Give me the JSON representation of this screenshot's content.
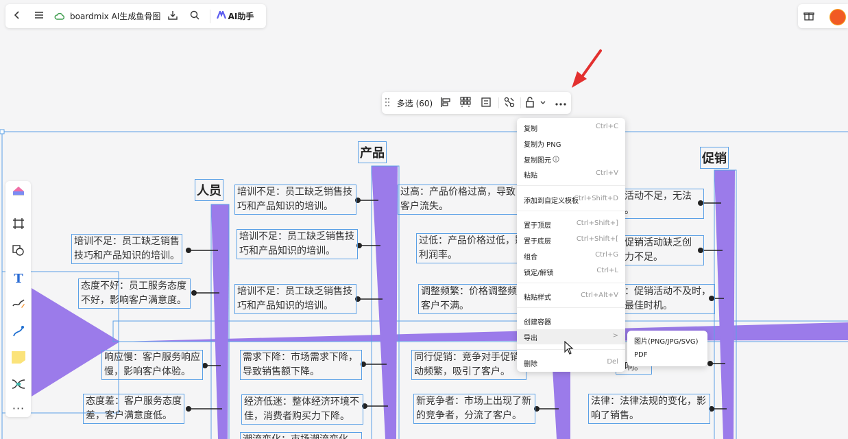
{
  "topbar": {
    "title": "boardmix AI生成鱼骨图",
    "ai_label": "AI助手"
  },
  "selection_toolbar": {
    "multi_select_label": "多选 (60)"
  },
  "context_menu": {
    "items": [
      {
        "label": "复制",
        "shortcut": "Ctrl+C"
      },
      {
        "label": "复制为 PNG",
        "shortcut": ""
      },
      {
        "label": "复制图元",
        "shortcut": ""
      },
      {
        "label": "粘贴",
        "shortcut": "Ctrl+V"
      },
      {
        "label": "添加到自定义模板",
        "shortcut": "Ctrl+Shift+D"
      },
      {
        "label": "置于顶层",
        "shortcut": "Ctrl+Shift+]"
      },
      {
        "label": "置于底层",
        "shortcut": "Ctrl+Shift+["
      },
      {
        "label": "组合",
        "shortcut": "Ctrl+G"
      },
      {
        "label": "锁定/解锁",
        "shortcut": "Ctrl+L"
      },
      {
        "label": "粘贴样式",
        "shortcut": "Ctrl+Alt+V"
      },
      {
        "label": "创建容器",
        "shortcut": ""
      },
      {
        "label": "导出",
        "shortcut": ">"
      },
      {
        "label": "删除",
        "shortcut": "Del"
      }
    ],
    "export_submenu": [
      {
        "label": "图片(PNG/JPG/SVG)"
      },
      {
        "label": "PDF"
      }
    ]
  },
  "fishbone": {
    "headers": {
      "people": "人员",
      "product": "产品",
      "promo": "促销"
    },
    "people": [
      {
        "l1": "培训不足：员工缺乏销售",
        "l2": "技巧和产品知识的培训。"
      },
      {
        "l1": "态度不好：员工服务态度",
        "l2": "不好，影响客户满意度。"
      },
      {
        "l1": "响应慢：客户服务响应",
        "l2": "慢，影响客户体验。"
      },
      {
        "l1": "态度差：客户服务态度",
        "l2": "差，客户满意度低。"
      }
    ],
    "product_left": [
      {
        "l1": "培训不足：员工缺乏销售技",
        "l2": "巧和产品知识的培训。"
      },
      {
        "l1": "培训不足：员工缺乏销售技",
        "l2": "巧和产品知识的培训。"
      },
      {
        "l1": "培训不足：员工缺乏销售技",
        "l2": "巧和产品知识的培训。"
      },
      {
        "l1": "需求下降：市场需求下降，",
        "l2": "导致销售额下降。"
      },
      {
        "l1": "经济低迷：整体经济环境不",
        "l2": "佳，消费者购买力下降。"
      },
      {
        "l1": "潮流变化：市场潮流变化",
        "l2": ""
      }
    ],
    "product_right": [
      {
        "l1": "过高：产品价格过高，导致",
        "l2": "客户流失。"
      },
      {
        "l1": "过低：产品价格过低，影",
        "l2": "利润率。"
      },
      {
        "l1": "调整频繁：价格调整频",
        "l2": "客户不满。"
      },
      {
        "l1": "同行促销：竞争对手促销",
        "l2": "动频繁，吸引了客户。"
      },
      {
        "l1": "新竞争者：市场上出现了新",
        "l2": "的竞争者，分流了客户。"
      }
    ],
    "promo": [
      {
        "l1": "活动不足，无法",
        "l2": "。"
      },
      {
        "l1": "促销活动缺乏创",
        "l2": "力不足。"
      },
      {
        "l1": "：促销活动不及时，",
        "l2": "最佳时机。"
      },
      {
        "l1": "法律：法律法规的变化，影",
        "l2": "响了销售。"
      }
    ],
    "promo_partial": "响。"
  }
}
